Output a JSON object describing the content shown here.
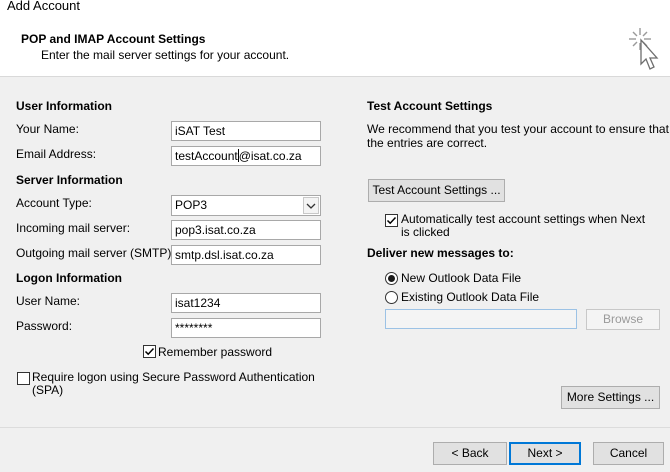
{
  "window": {
    "title": "Add Account"
  },
  "header": {
    "title": "POP and IMAP Account Settings",
    "subtitle": "Enter the mail server settings for your account.",
    "icon": "magic-wand-cursor-icon"
  },
  "user_info": {
    "section": "User Information",
    "name_label": "Your Name:",
    "name_value": "iSAT Test",
    "email_label": "Email Address:",
    "email_value_before": "testAccount",
    "email_value_after": "@isat.co.za"
  },
  "server_info": {
    "section": "Server Information",
    "account_type_label": "Account Type:",
    "account_type_value": "POP3",
    "incoming_label": "Incoming mail server:",
    "incoming_value": "pop3.isat.co.za",
    "outgoing_label": "Outgoing mail server (SMTP):",
    "outgoing_value": "smtp.dsl.isat.co.za"
  },
  "logon_info": {
    "section": "Logon Information",
    "username_label": "User Name:",
    "username_value": "isat1234",
    "password_label": "Password:",
    "password_value": "********",
    "remember_label": "Remember password",
    "remember_checked": true,
    "spa_label_line1": "Require logon using Secure Password Authentication",
    "spa_label_line2": "(SPA)",
    "spa_checked": false
  },
  "test_settings": {
    "section": "Test Account Settings",
    "description_line1": "We recommend that you test your account to ensure that",
    "description_line2": "the entries are correct.",
    "test_button": "Test Account Settings ...",
    "auto_test_line1": "Automatically test account settings when Next",
    "auto_test_line2": "is clicked",
    "auto_test_checked": true
  },
  "deliver": {
    "section": "Deliver new messages to:",
    "new_file_label": "New Outlook Data File",
    "existing_file_label": "Existing Outlook Data File",
    "selected": "new",
    "path_value": "",
    "browse_button": "Browse"
  },
  "buttons": {
    "more_settings": "More Settings ...",
    "back": "< Back",
    "next": "Next >",
    "cancel": "Cancel"
  }
}
